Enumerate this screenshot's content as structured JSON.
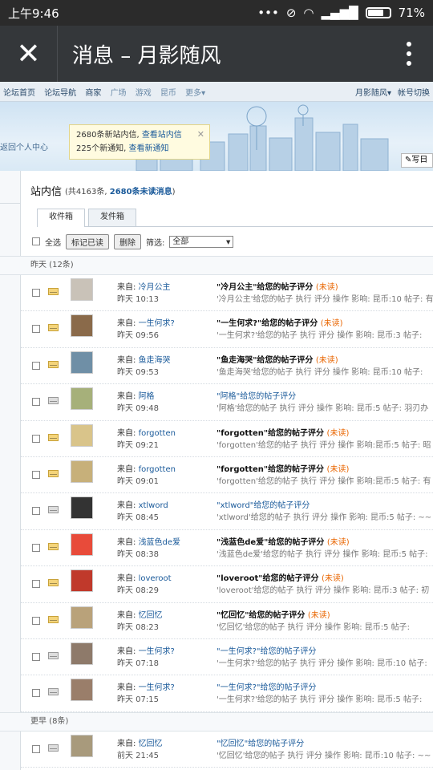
{
  "status": {
    "time": "上午9:46",
    "battery": "71%"
  },
  "appbar": {
    "title": "消息 – 月影随风"
  },
  "nav": {
    "items": [
      "论坛首页",
      "论坛导航",
      "商家",
      "广场",
      "游戏",
      "昆币",
      "更多▾"
    ],
    "user": "月影随风▾",
    "account": "帐号切换"
  },
  "banner": {
    "back": "返回个人中心",
    "notice_line1": "2680条新站内信, ",
    "notice_link1": "查看站内信",
    "notice_line2": "225个新通知, ",
    "notice_link2": "查看新通知",
    "write": "写日"
  },
  "pm": {
    "title": "站内信",
    "count_prefix": "(共4163条, ",
    "count_unread": "2680条未读消息",
    "count_suffix": ")",
    "tab_inbox": "收件箱",
    "tab_outbox": "发件箱",
    "select_all": "全选",
    "mark_read": "标记已读",
    "delete": "删除",
    "filter_label": "筛选:",
    "filter_value": "全部"
  },
  "groups": {
    "yesterday": "昨天 (12条)",
    "earlier": "更早 (8条)"
  },
  "messages": [
    {
      "from_label": "来自: ",
      "user": "冷月公主",
      "time": "昨天 10:13",
      "subject": "\"冷月公主\"给您的帖子评分",
      "unread": "(未读)",
      "preview": "'冷月公主'给您的帖子 执行 评分 操作 影响: 昆币:10 帖子: 有"
    },
    {
      "from_label": "来自: ",
      "user": "一生何求?",
      "time": "昨天 09:56",
      "subject": "\"一生何求?\"给您的帖子评分",
      "unread": "(未读)",
      "preview": "'一生何求?'给您的帖子 执行 评分 操作 影响: 昆币:3 帖子:"
    },
    {
      "from_label": "来自: ",
      "user": "鱼走海哭",
      "time": "昨天 09:53",
      "subject": "\"鱼走海哭\"给您的帖子评分",
      "unread": "(未读)",
      "preview": "'鱼走海哭'给您的帖子 执行 评分 操作 影响: 昆币:10 帖子:"
    },
    {
      "from_label": "来自: ",
      "user": "阿格",
      "time": "昨天 09:48",
      "subject": "\"阿格\"给您的帖子评分",
      "unread": "",
      "preview": "'阿格'给您的帖子 执行 评分 操作 影响: 昆币:5 帖子: 羽刃办"
    },
    {
      "from_label": "来自: ",
      "user": "forgotten",
      "time": "昨天 09:21",
      "subject": "\"forgotten\"给您的帖子评分",
      "unread": "(未读)",
      "preview": "'forgotten'给您的帖子 执行 评分 操作 影响:昆币:5 帖子: 昭"
    },
    {
      "from_label": "来自: ",
      "user": "forgotten",
      "time": "昨天 09:01",
      "subject": "\"forgotten\"给您的帖子评分",
      "unread": "(未读)",
      "preview": "'forgotten'给您的帖子 执行 评分 操作 影响:昆币:5 帖子: 有"
    },
    {
      "from_label": "来自: ",
      "user": "xtlword",
      "time": "昨天 08:45",
      "subject": "\"xtlword\"给您的帖子评分",
      "unread": "",
      "preview": "'xtlword'给您的帖子 执行 评分 操作 影响: 昆币:5 帖子: ~~"
    },
    {
      "from_label": "来自: ",
      "user": "浅蓝色de爱",
      "time": "昨天 08:38",
      "subject": "\"浅蓝色de爱\"给您的帖子评分",
      "unread": "(未读)",
      "preview": "'浅蓝色de爱'给您的帖子 执行 评分 操作 影响: 昆币:5 帖子:"
    },
    {
      "from_label": "来自: ",
      "user": "loveroot",
      "time": "昨天 08:29",
      "subject": "\"loveroot\"给您的帖子评分",
      "unread": "(未读)",
      "preview": "'loveroot'给您的帖子 执行 评分 操作 影响: 昆币:3 帖子: 初"
    },
    {
      "from_label": "来自: ",
      "user": "忆回忆",
      "time": "昨天 08:23",
      "subject": "\"忆回忆\"给您的帖子评分",
      "unread": "(未读)",
      "preview": "'忆回忆'给您的帖子 执行 评分 操作 影响: 昆币:5 帖子:"
    },
    {
      "from_label": "来自: ",
      "user": "一生何求?",
      "time": "昨天 07:18",
      "subject": "\"一生何求?\"给您的帖子评分",
      "unread": "",
      "preview": "'一生何求?'给您的帖子 执行 评分 操作 影响: 昆币:10 帖子:"
    },
    {
      "from_label": "来自: ",
      "user": "一生何求?",
      "time": "昨天 07:15",
      "subject": "\"一生何求?\"给您的帖子评分",
      "unread": "",
      "preview": "'一生何求?'给您的帖子 执行 评分 操作 影响: 昆币:5 帖子:"
    }
  ],
  "earlier_messages": [
    {
      "from_label": "来自: ",
      "user": "忆回忆",
      "time": "前天 21:45",
      "subject": "\"忆回忆\"给您的帖子评分",
      "unread": "",
      "preview": "'忆回忆'给您的帖子 执行 评分 操作 影响: 昆币:10 帖子: ~~"
    }
  ]
}
